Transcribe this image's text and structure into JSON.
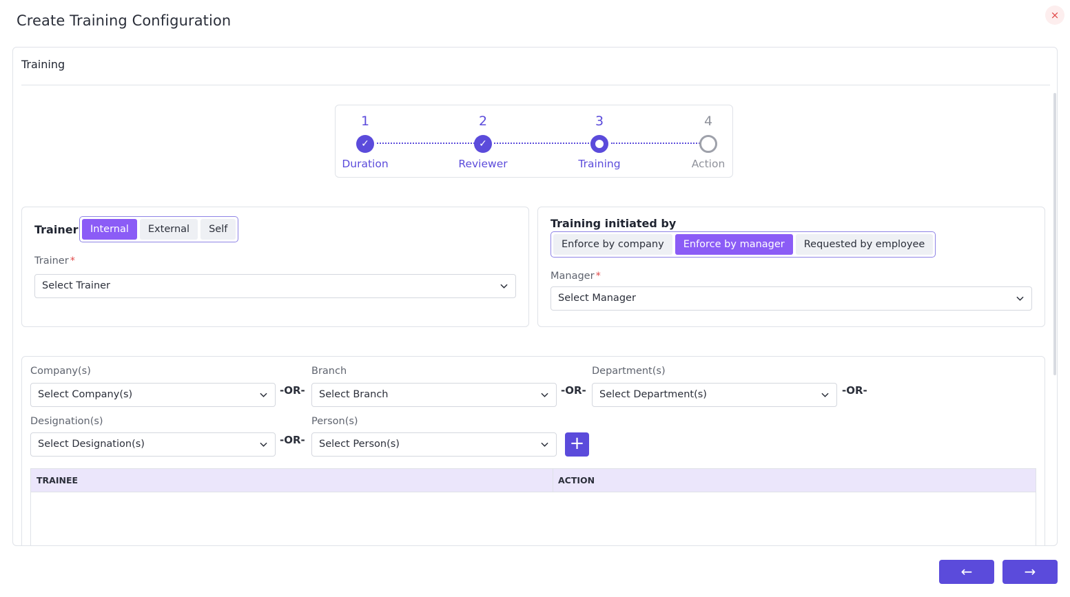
{
  "dialog": {
    "title": "Create Training Configuration",
    "close_icon": "×"
  },
  "panel": {
    "title": "Training"
  },
  "stepper": {
    "steps": [
      {
        "num": "1",
        "label": "Duration",
        "state": "done",
        "icon": "✓"
      },
      {
        "num": "2",
        "label": "Reviewer",
        "state": "done",
        "icon": "✓"
      },
      {
        "num": "3",
        "label": "Training",
        "state": "active",
        "icon": ""
      },
      {
        "num": "4",
        "label": "Action",
        "state": "pending",
        "icon": ""
      }
    ]
  },
  "trainer_card": {
    "title": "Trainer",
    "options": [
      "Internal",
      "External",
      "Self"
    ],
    "selected": "Internal",
    "field_label": "Trainer",
    "required_mark": "*",
    "select_value": "Select Trainer"
  },
  "initiated_card": {
    "title": "Training initiated by",
    "options": [
      "Enforce by company",
      "Enforce by manager",
      "Requested by employee"
    ],
    "selected": "Enforce by manager",
    "field_label": "Manager",
    "required_mark": "*",
    "select_value": "Select Manager"
  },
  "filters": {
    "or_text": "-OR-",
    "company": {
      "label": "Company(s)",
      "value": "Select Company(s)"
    },
    "branch": {
      "label": "Branch",
      "value": "Select Branch"
    },
    "department": {
      "label": "Department(s)",
      "value": "Select Department(s)"
    },
    "designation": {
      "label": "Designation(s)",
      "value": "Select Designation(s)"
    },
    "person": {
      "label": "Person(s)",
      "value": "Select Person(s)"
    },
    "add_icon": "+"
  },
  "table": {
    "columns": [
      "TRAINEE",
      "ACTION"
    ],
    "rows": []
  },
  "footer": {
    "back_icon": "←",
    "next_icon": "→"
  },
  "colors": {
    "accent": "#5b4bdb",
    "segment_selected": "#8b5cf6",
    "table_header": "#ebe6fb"
  }
}
